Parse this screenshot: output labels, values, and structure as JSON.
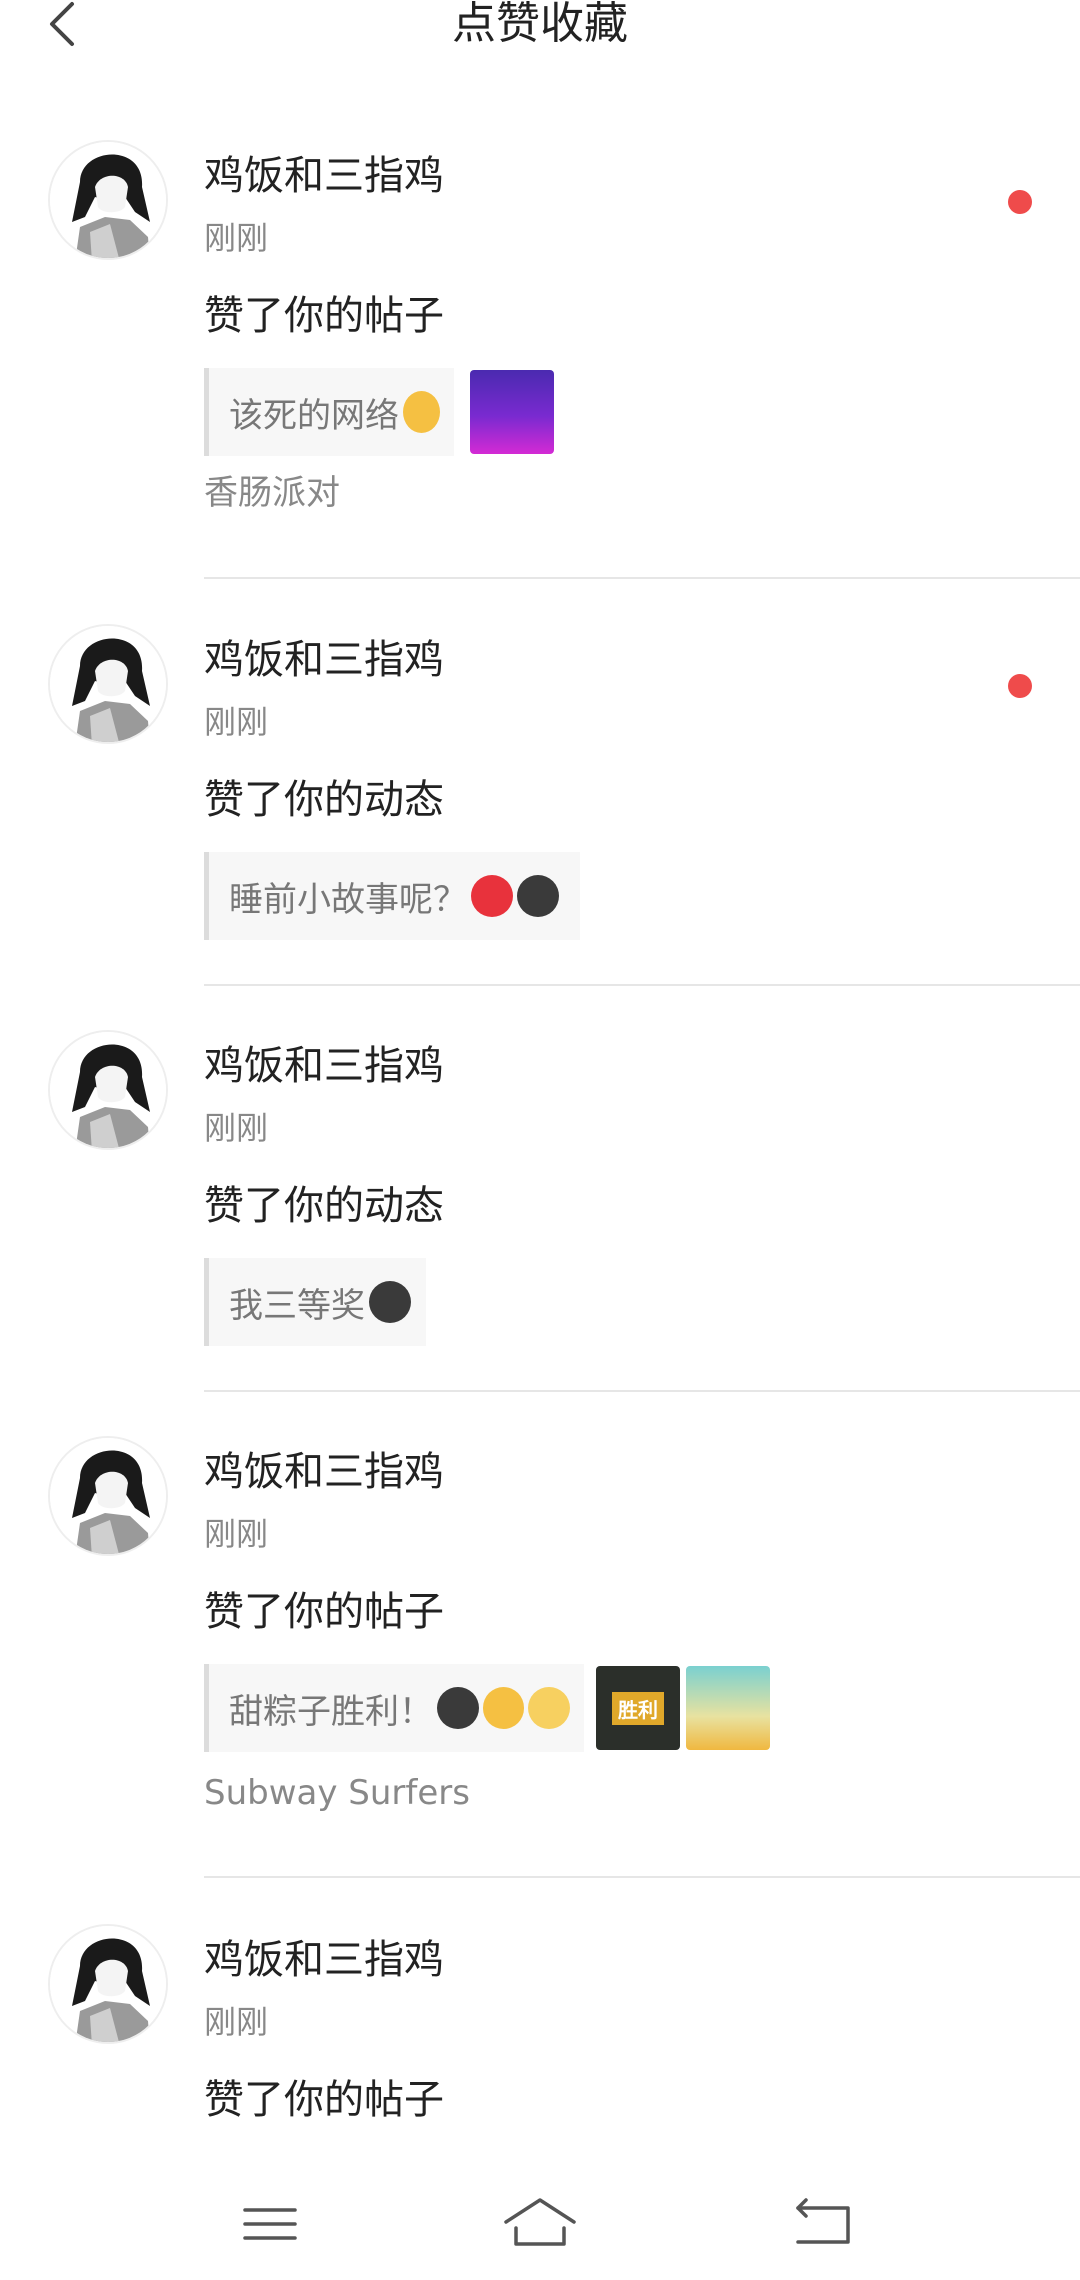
{
  "header": {
    "title": "点赞收藏"
  },
  "items": [
    {
      "name": "鸡饭和三指鸡",
      "time": "刚刚",
      "action": "赞了你的帖子",
      "quote": "该死的网络",
      "source": "香肠派对",
      "unread": true
    },
    {
      "name": "鸡饭和三指鸡",
      "time": "刚刚",
      "action": "赞了你的动态",
      "quote": "睡前小故事呢？",
      "source": "",
      "unread": true
    },
    {
      "name": "鸡饭和三指鸡",
      "time": "刚刚",
      "action": "赞了你的动态",
      "quote": "我三等奖",
      "source": "",
      "unread": false
    },
    {
      "name": "鸡饭和三指鸡",
      "time": "刚刚",
      "action": "赞了你的帖子",
      "quote": "甜粽子胜利！",
      "source": "Subway Surfers",
      "unread": false,
      "thumb_label": "胜利"
    },
    {
      "name": "鸡饭和三指鸡",
      "time": "刚刚",
      "action": "赞了你的帖子",
      "quote": "",
      "source": "",
      "unread": false
    }
  ],
  "icons": {
    "back": "chevron-left-icon",
    "menu": "menu-icon",
    "home": "home-icon",
    "return": "return-icon"
  },
  "colors": {
    "unread_dot": "#ef4b4b",
    "muted_text": "#888888",
    "quote_bg": "#f7f7f7"
  }
}
